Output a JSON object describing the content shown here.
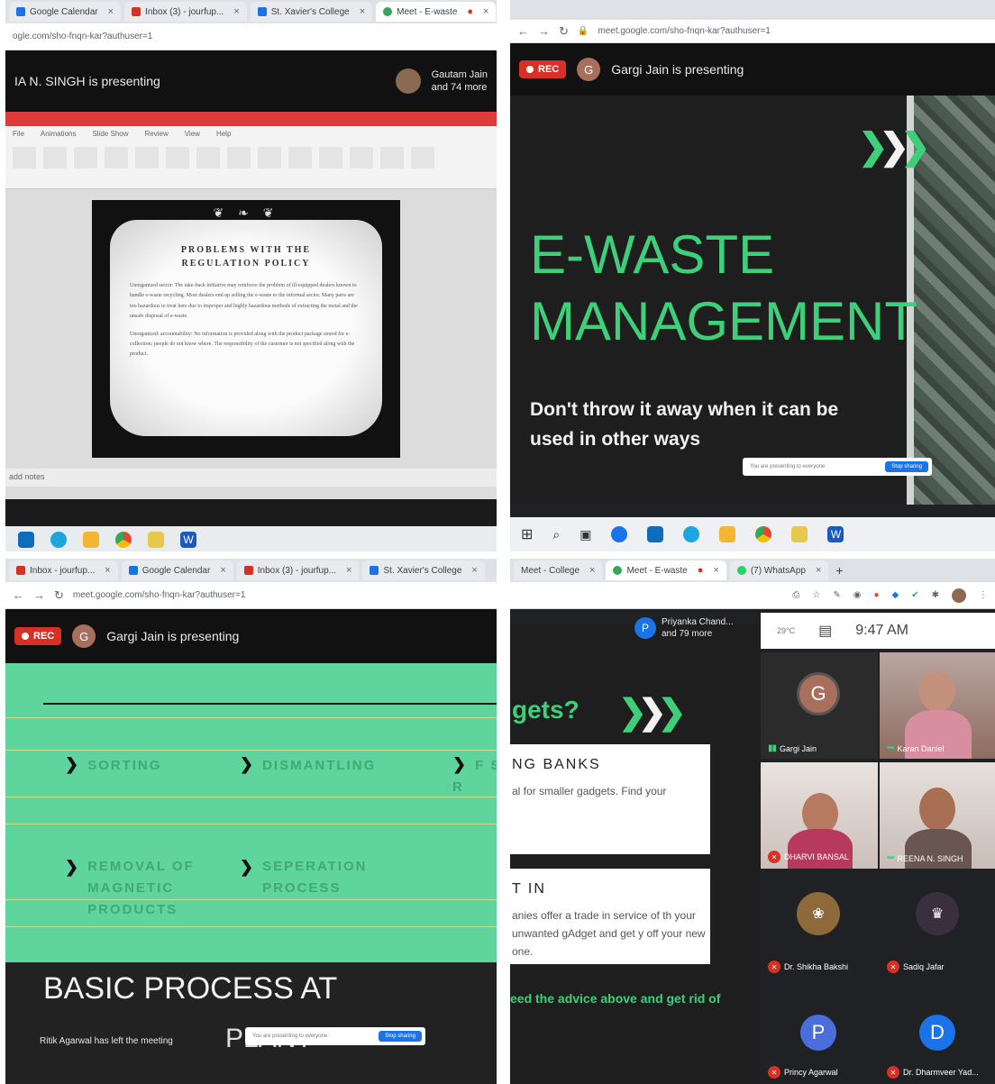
{
  "q1": {
    "tabs": [
      "Google Calendar",
      "Inbox (3) - jourfup...",
      "St. Xavier's College",
      "Meet - E-waste"
    ],
    "url": "ogle.com/sho-fnqn-kar?authuser=1",
    "presenter": "IA N. SINGH is presenting",
    "viewer": "Gautam Jain",
    "viewer_more": "and 74 more",
    "ribbon_menu": [
      "File",
      "Animations",
      "Slide Show",
      "Review",
      "View",
      "Help"
    ],
    "slide_title_1": "PROBLEMS WITH THE",
    "slide_title_2": "REGULATION POLICY",
    "para1": "Unorganized sector: The take-back initiative may reinforce the problem of ill-equipped dealers known to handle e-waste recycling. Most dealers end up selling the e-waste to the informal sector. Many parts are too hazardous to treat here due to improper and highly hazardous methods of extracting the metal and the unsafe disposal of e-waste.",
    "para2": "Unorganized: accountability: No information is provided along with the product package stored for e-collection; people do not know where. The responsibility of the customer is not specified along with the product.",
    "notes": "add notes"
  },
  "q2": {
    "url": "meet.google.com/sho-fnqn-kar?authuser=1",
    "rec": "REC",
    "avatar": "G",
    "presenter": "Gargi Jain is presenting",
    "title_1": "E-WASTE",
    "title_2": "MANAGEMENT",
    "subtitle": "Don't throw it away when it can be used in other ways",
    "share_text": "You are presenting to everyone",
    "share_btn": "Stop sharing"
  },
  "q3": {
    "tabs": [
      "Inbox - jourfup...",
      "Google Calendar",
      "Inbox (3) - jourfup...",
      "St. Xavier's College"
    ],
    "url": "meet.google.com/sho-fnqn-kar?authuser=1",
    "rec": "REC",
    "avatar": "G",
    "presenter": "Gargi Jain is presenting",
    "steps": [
      "SORTING",
      "DISMANTLING",
      "REMOVAL OF MAGNETIC PRODUCTS",
      "SEPERATION PROCESS"
    ],
    "step3_partial": "F S R",
    "bottom_title": "BASIC PROCESS AT",
    "bottom_partial": "PLANT",
    "left_note": "Ritik Agarwal has left the meeting",
    "share_text": "You are presenting to everyone",
    "share_btn": "Stop sharing"
  },
  "q4": {
    "tabs": [
      "Meet - College",
      "Meet - E-waste",
      "(7) WhatsApp"
    ],
    "presenter_name": "Priyanka Chand...",
    "presenter_more": "and 79 more",
    "presenter_avatar": "P",
    "weather": "29°C",
    "time": "9:47 AM",
    "gadget_head": "gets?",
    "card1_title": "NG BANKS",
    "card1_body": "al for smaller gadgets. Find your",
    "card2_title": "T IN",
    "card2_body": "anies offer a trade in service of th your unwanted gAdget and get y off your new one.",
    "advice": "eed the advice above and get rid of",
    "participants": [
      {
        "name": "Gargi Jain",
        "avatar": "G"
      },
      {
        "name": "Karan Daniel"
      },
      {
        "name": "DHARVI BANSAL"
      },
      {
        "name": "REENA N. SINGH"
      },
      {
        "name": "Dr. Shikha Bakshi"
      },
      {
        "name": "Sadiq Jafar"
      },
      {
        "name": "Princy Agarwal",
        "avatar": "P"
      },
      {
        "name": "Dr. Dharmveer Yad...",
        "avatar": "D"
      }
    ]
  },
  "colors": {
    "accent_green": "#3ecf7a",
    "rec_red": "#d93025",
    "meet_blue": "#1a73e8"
  }
}
